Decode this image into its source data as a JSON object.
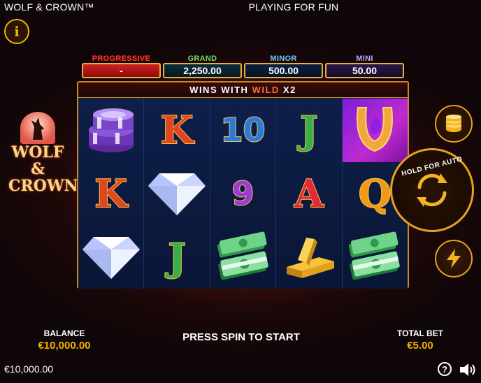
{
  "header": {
    "game_title": "WOLF & CROWN™",
    "mode": "PLAYING FOR FUN",
    "info_label": "i"
  },
  "jackpots": [
    {
      "name": "PROGRESSIVE",
      "value": "-"
    },
    {
      "name": "GRAND",
      "value": "2,250.00"
    },
    {
      "name": "MINOR",
      "value": "500.00"
    },
    {
      "name": "MINI",
      "value": "50.00"
    }
  ],
  "banner": {
    "prefix": "WINS WITH",
    "wild": "WILD",
    "suffix": "X2"
  },
  "logo": {
    "line1": "WOLF &",
    "line2": "CROWN"
  },
  "reels": [
    [
      "chips",
      "diamond-K",
      "diamond"
    ],
    [
      "K",
      "diamond",
      "J"
    ],
    [
      "10",
      "9",
      "cash"
    ],
    [
      "J",
      "A",
      "gold-bars"
    ],
    [
      "horseshoe-wild",
      "Q",
      "cash"
    ]
  ],
  "symbol_labels": {
    "r1c2": "K",
    "r2c1": "K",
    "r2c3": "J",
    "r3c1": "10",
    "r3c2": "9",
    "r4c1": "J",
    "r4c2": "A",
    "r5c2": "Q"
  },
  "controls": {
    "auto_label": "HOLD FOR AUTO"
  },
  "footer": {
    "balance_label": "BALANCE",
    "balance_value": "€10,000.00",
    "prompt": "PRESS SPIN TO START",
    "total_bet_label": "TOTAL BET",
    "total_bet_value": "€5.00",
    "bottom_balance": "€10,000.00",
    "help_label": "?"
  },
  "colors": {
    "accent_gold": "#f4b400",
    "frame": "#c98a2a"
  }
}
